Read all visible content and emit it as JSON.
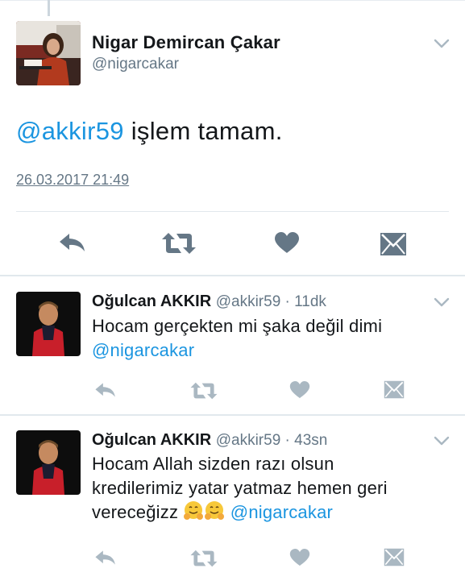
{
  "main_tweet": {
    "display_name": "Nigar Demircan Çakar",
    "handle": "@nigarcakar",
    "mention": "@akkir59",
    "text": " işlem tamam.",
    "timestamp": "26.03.2017 21:49",
    "actions": [
      "reply-icon",
      "retweet-icon",
      "like-icon",
      "direct-message-icon"
    ]
  },
  "replies": [
    {
      "display_name": "Oğulcan AKKIR",
      "meta": "@akkir59 · 11dk",
      "text": "Hocam gerçekten mi şaka değil dimi",
      "mention": "@nigarcakar"
    },
    {
      "display_name": "Oğulcan AKKIR",
      "meta": "@akkir59 · 43sn",
      "text": "Hocam Allah sizden razı olsun kredilerimiz yatar yatmaz hemen geri vereceğizz",
      "emojis": [
        "hugging-face-emoji",
        "hugging-face-emoji"
      ],
      "mention": "@nigarcakar"
    }
  ],
  "colors": {
    "accent": "#1b95e0",
    "muted_text": "#657786",
    "main_action_icon": "#657786",
    "reply_action_icon": "#aab8c2",
    "divider": "#e1e8ed"
  }
}
